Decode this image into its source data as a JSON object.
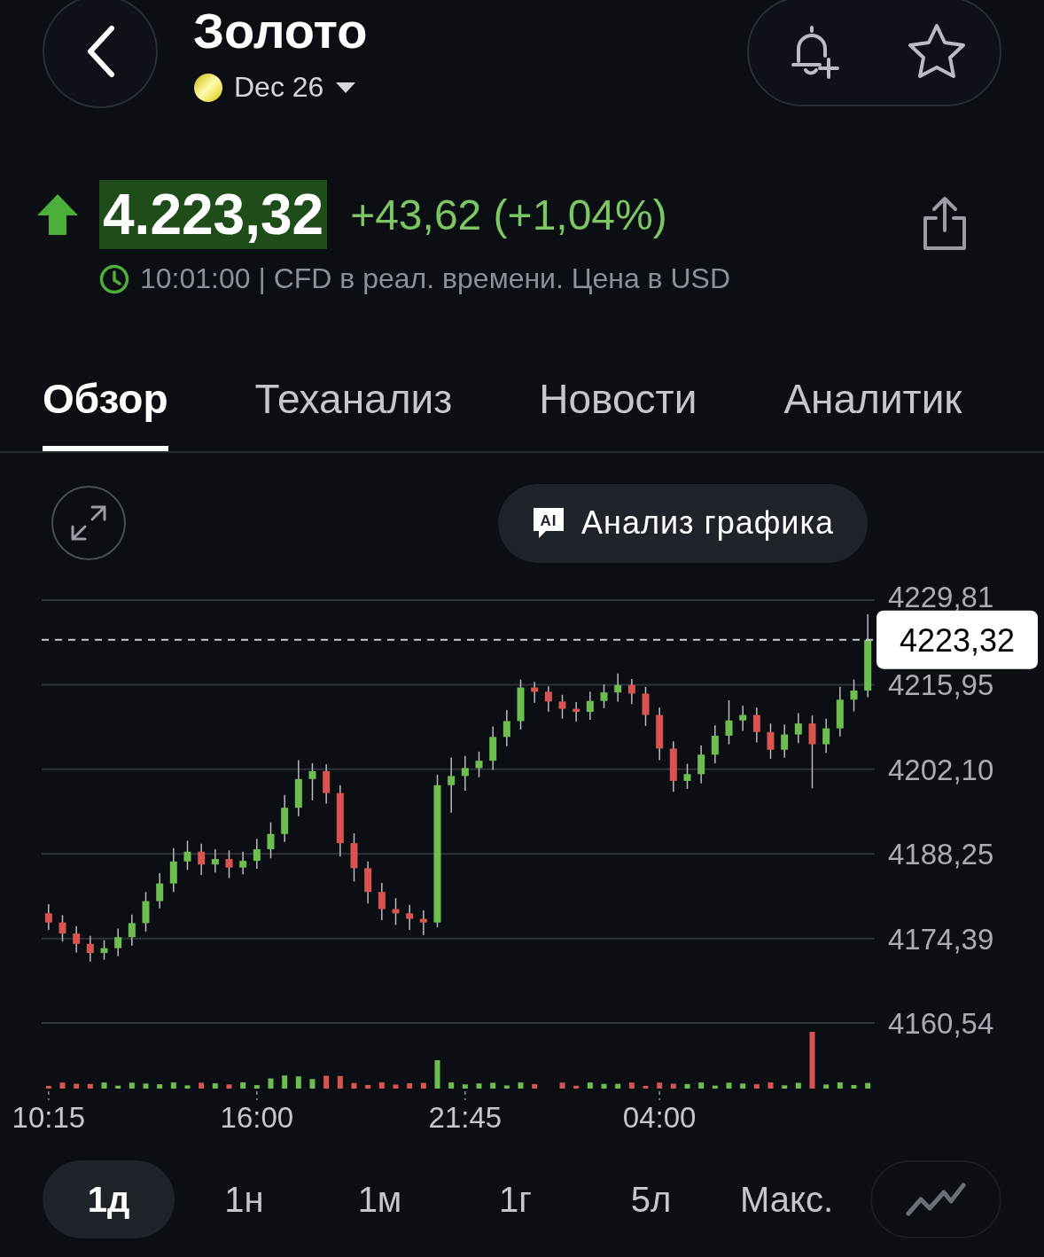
{
  "header": {
    "title": "Золото",
    "contract": "Dec 26"
  },
  "quote": {
    "rising": true,
    "price": "4.223,32",
    "change": "+43,62 (+1,04%)",
    "note": "10:01:00 | CFD в реал. времени. Цена в USD"
  },
  "tabs": [
    {
      "label": "Обзор",
      "selected": true
    },
    {
      "label": "Теханализ",
      "selected": false
    },
    {
      "label": "Новости",
      "selected": false
    },
    {
      "label": "Аналитик",
      "selected": false
    }
  ],
  "chart": {
    "ai_badge": "AI",
    "ai_button": "Анализ графика",
    "chart_data": {
      "type": "candlestick",
      "grid": true,
      "categories": [
        "10:15",
        null,
        null,
        null,
        null,
        null,
        null,
        null,
        null,
        null,
        null,
        null,
        null,
        null,
        null,
        "16:00",
        null,
        null,
        null,
        null,
        null,
        null,
        null,
        null,
        null,
        null,
        null,
        null,
        null,
        null,
        "21:45",
        null,
        null,
        null,
        null,
        null,
        null,
        null,
        null,
        null,
        null,
        null,
        null,
        null,
        "04:00",
        null,
        null,
        null,
        null,
        null,
        null,
        null,
        null,
        null,
        null,
        null,
        null,
        null,
        null,
        null
      ],
      "ref_lines": [
        {
          "axis": "y",
          "value": 4223.32,
          "label": "4223,32"
        }
      ],
      "ohlc": [
        [
          4178.5,
          4180.0,
          4175.8,
          4177.0
        ],
        [
          4177.0,
          4178.2,
          4173.9,
          4175.2
        ],
        [
          4175.2,
          4176.4,
          4172.1,
          4173.5
        ],
        [
          4173.5,
          4174.8,
          4170.6,
          4172.0
        ],
        [
          4172.0,
          4174.1,
          4170.9,
          4172.8
        ],
        [
          4172.8,
          4176.0,
          4171.5,
          4174.6
        ],
        [
          4174.6,
          4178.3,
          4173.2,
          4176.9
        ],
        [
          4176.9,
          4182.0,
          4175.5,
          4180.5
        ],
        [
          4180.5,
          4185.1,
          4179.3,
          4183.4
        ],
        [
          4183.4,
          4189.2,
          4182.0,
          4187.0
        ],
        [
          4187.0,
          4190.4,
          4185.6,
          4188.6
        ],
        [
          4188.6,
          4189.9,
          4184.8,
          4186.5
        ],
        [
          4186.5,
          4189.0,
          4185.2,
          4187.4
        ],
        [
          4187.4,
          4188.8,
          4184.3,
          4186.0
        ],
        [
          4186.0,
          4188.6,
          4184.9,
          4187.1
        ],
        [
          4187.1,
          4190.7,
          4185.8,
          4189.0
        ],
        [
          4189.0,
          4193.4,
          4187.5,
          4191.5
        ],
        [
          4191.5,
          4197.9,
          4190.2,
          4195.8
        ],
        [
          4195.8,
          4203.6,
          4194.4,
          4200.5
        ],
        [
          4200.5,
          4203.1,
          4197.0,
          4201.8
        ],
        [
          4201.8,
          4202.9,
          4196.5,
          4198.2
        ],
        [
          4198.2,
          4199.5,
          4187.8,
          4190.0
        ],
        [
          4190.0,
          4191.6,
          4183.7,
          4185.9
        ],
        [
          4185.9,
          4187.0,
          4180.1,
          4182.0
        ],
        [
          4182.0,
          4183.5,
          4177.4,
          4179.2
        ],
        [
          4179.2,
          4181.0,
          4176.6,
          4178.5
        ],
        [
          4178.5,
          4179.9,
          4175.8,
          4177.6
        ],
        [
          4177.6,
          4179.0,
          4174.9,
          4177.0
        ],
        [
          4177.0,
          4201.2,
          4176.2,
          4199.5
        ],
        [
          4199.5,
          4204.0,
          4195.0,
          4201.0
        ],
        [
          4201.0,
          4204.3,
          4198.6,
          4202.3
        ],
        [
          4202.3,
          4205.0,
          4200.8,
          4203.5
        ],
        [
          4203.5,
          4209.1,
          4202.0,
          4207.4
        ],
        [
          4207.4,
          4211.8,
          4205.9,
          4210.0
        ],
        [
          4210.0,
          4216.8,
          4208.6,
          4215.5
        ],
        [
          4215.5,
          4216.4,
          4213.0,
          4214.8
        ],
        [
          4214.8,
          4215.7,
          4211.5,
          4213.2
        ],
        [
          4213.2,
          4214.3,
          4210.4,
          4212.0
        ],
        [
          4212.0,
          4213.1,
          4209.9,
          4211.5
        ],
        [
          4211.5,
          4214.8,
          4210.2,
          4213.3
        ],
        [
          4213.3,
          4216.0,
          4212.1,
          4214.7
        ],
        [
          4214.7,
          4217.8,
          4213.2,
          4215.9
        ],
        [
          4215.9,
          4216.9,
          4212.8,
          4214.5
        ],
        [
          4214.5,
          4215.6,
          4209.2,
          4211.0
        ],
        [
          4211.0,
          4212.2,
          4203.6,
          4205.5
        ],
        [
          4205.5,
          4206.7,
          4198.4,
          4200.2
        ],
        [
          4200.2,
          4203.0,
          4198.9,
          4201.3
        ],
        [
          4201.3,
          4206.0,
          4199.8,
          4204.5
        ],
        [
          4204.5,
          4209.3,
          4203.1,
          4207.6
        ],
        [
          4207.6,
          4213.4,
          4206.2,
          4210.1
        ],
        [
          4210.1,
          4212.5,
          4208.4,
          4211.0
        ],
        [
          4211.0,
          4212.2,
          4206.5,
          4208.2
        ],
        [
          4208.2,
          4209.6,
          4203.8,
          4205.3
        ],
        [
          4205.3,
          4209.4,
          4204.0,
          4207.8
        ],
        [
          4207.8,
          4211.3,
          4206.4,
          4209.6
        ],
        [
          4209.6,
          4210.9,
          4199.0,
          4206.2
        ],
        [
          4206.2,
          4210.4,
          4204.8,
          4208.8
        ],
        [
          4208.8,
          4215.6,
          4207.5,
          4213.5
        ],
        [
          4213.5,
          4216.8,
          4211.6,
          4215.0
        ],
        [
          4215.0,
          4227.5,
          4213.9,
          4223.3
        ]
      ],
      "ylim": [
        4160.54,
        4229.81
      ],
      "yticks": [
        {
          "value": 4229.81,
          "label": "4229,81"
        },
        {
          "value": 4215.95,
          "label": "4215,95"
        },
        {
          "value": 4202.1,
          "label": "4202,10"
        },
        {
          "value": 4188.25,
          "label": "4188,25"
        },
        {
          "value": 4174.39,
          "label": "4174,39"
        },
        {
          "value": 4160.54,
          "label": "4160,54"
        }
      ]
    }
  },
  "periods": [
    {
      "label": "1д",
      "selected": true
    },
    {
      "label": "1н",
      "selected": false
    },
    {
      "label": "1м",
      "selected": false
    },
    {
      "label": "1г",
      "selected": false
    },
    {
      "label": "5л",
      "selected": false
    },
    {
      "label": "Макс.",
      "selected": false
    }
  ]
}
